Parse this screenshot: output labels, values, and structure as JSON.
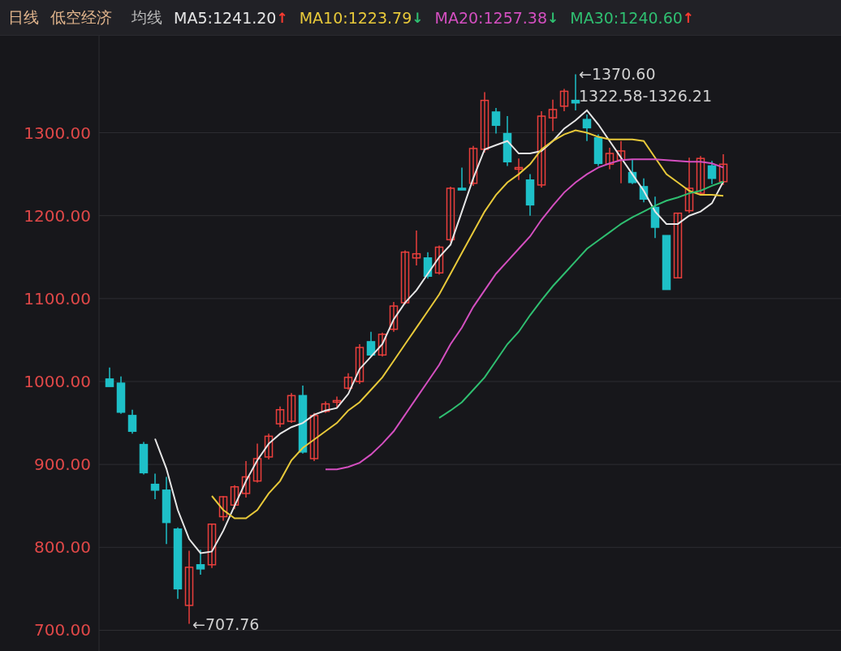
{
  "header": {
    "period": "日线",
    "sector": "低空经济",
    "ma_label": "均线",
    "indicators": [
      {
        "label": "MA5:1241.20",
        "arrow": {
          "text": "↑",
          "color": "#ff3b30"
        },
        "color": "#e6e6e6"
      },
      {
        "label": "MA10:1223.79",
        "arrow": {
          "text": "↓",
          "color": "#2fbf71"
        },
        "color": "#e8c93a"
      },
      {
        "label": "MA20:1257.38",
        "arrow": {
          "text": "↓",
          "color": "#2fbf71"
        },
        "color": "#d44fc0"
      },
      {
        "label": "MA30:1240.60",
        "arrow": {
          "text": "↑",
          "color": "#ff3b30"
        },
        "color": "#2fbf71"
      }
    ]
  },
  "chart_data": {
    "type": "candlestick",
    "ylim": [
      675,
      1417
    ],
    "grid": true,
    "yticks": [
      {
        "value": 700,
        "label": "700.00"
      },
      {
        "value": 800,
        "label": "800.00"
      },
      {
        "value": 900,
        "label": "900.00"
      },
      {
        "value": 1000,
        "label": "1000.00"
      },
      {
        "value": 1100,
        "label": "1100.00"
      },
      {
        "value": 1200,
        "label": "1200.00"
      },
      {
        "value": 1300,
        "label": "1300.00"
      }
    ],
    "series": [
      {
        "type": "line",
        "color": "#e6e6e6",
        "values": [
          null,
          null,
          null,
          null,
          931,
          895,
          845,
          810,
          793,
          795,
          820,
          850,
          880,
          905,
          925,
          937,
          945,
          950,
          960,
          965,
          968,
          985,
          1015,
          1030,
          1045,
          1075,
          1095,
          1110,
          1130,
          1150,
          1165,
          1205,
          1245,
          1280,
          1285,
          1290,
          1275,
          1275,
          1278,
          1290,
          1305,
          1315,
          1327,
          1310,
          1290,
          1270,
          1250,
          1230,
          1205,
          1190,
          1190,
          1200,
          1205,
          1215,
          1241
        ]
      },
      {
        "type": "line",
        "color": "#e8c93a",
        "values": [
          null,
          null,
          null,
          null,
          null,
          null,
          null,
          null,
          null,
          862,
          845,
          835,
          835,
          845,
          865,
          880,
          905,
          920,
          930,
          940,
          950,
          965,
          975,
          990,
          1005,
          1025,
          1045,
          1065,
          1085,
          1105,
          1130,
          1155,
          1180,
          1205,
          1225,
          1240,
          1250,
          1262,
          1280,
          1290,
          1298,
          1303,
          1300,
          1295,
          1292,
          1292,
          1292,
          1290,
          1270,
          1250,
          1240,
          1230,
          1225,
          1225,
          1224
        ]
      },
      {
        "type": "line",
        "color": "#d44fc0",
        "values": [
          null,
          null,
          null,
          null,
          null,
          null,
          null,
          null,
          null,
          null,
          null,
          null,
          null,
          null,
          null,
          null,
          null,
          null,
          null,
          894,
          894,
          897,
          902,
          912,
          925,
          940,
          960,
          980,
          1000,
          1020,
          1045,
          1065,
          1090,
          1110,
          1130,
          1145,
          1160,
          1175,
          1195,
          1212,
          1228,
          1240,
          1250,
          1258,
          1263,
          1267,
          1268,
          1268,
          1268,
          1267,
          1266,
          1265,
          1265,
          1263,
          1258
        ]
      },
      {
        "type": "line",
        "color": "#2fbf71",
        "values": [
          null,
          null,
          null,
          null,
          null,
          null,
          null,
          null,
          null,
          null,
          null,
          null,
          null,
          null,
          null,
          null,
          null,
          null,
          null,
          null,
          null,
          null,
          null,
          null,
          null,
          null,
          null,
          null,
          null,
          956,
          965,
          975,
          990,
          1005,
          1025,
          1045,
          1060,
          1080,
          1098,
          1115,
          1130,
          1145,
          1160,
          1170,
          1180,
          1190,
          1198,
          1205,
          1212,
          1218,
          1222,
          1227,
          1230,
          1236,
          1241
        ]
      }
    ],
    "ohlc": [
      [
        1003,
        1017,
        994,
        994
      ],
      [
        998,
        1006,
        961,
        963
      ],
      [
        959,
        966,
        937,
        940
      ],
      [
        924,
        927,
        888,
        890
      ],
      [
        876,
        889,
        858,
        869
      ],
      [
        869,
        885,
        804,
        830
      ],
      [
        822,
        824,
        738,
        750
      ],
      [
        730,
        796,
        707.76,
        776
      ],
      [
        779,
        797,
        767,
        774
      ],
      [
        779,
        828,
        775,
        828
      ],
      [
        837,
        862,
        832,
        861
      ],
      [
        851,
        875,
        846,
        873
      ],
      [
        865,
        904,
        860,
        885
      ],
      [
        880,
        925,
        878,
        907
      ],
      [
        909,
        937,
        906,
        934
      ],
      [
        949,
        970,
        945,
        966
      ],
      [
        952,
        986,
        950,
        983
      ],
      [
        983,
        995,
        913,
        915
      ],
      [
        907,
        962,
        904,
        959
      ],
      [
        964,
        976,
        962,
        973
      ],
      [
        975,
        982,
        968,
        977
      ],
      [
        992,
        1010,
        990,
        1005
      ],
      [
        1000,
        1045,
        997,
        1041
      ],
      [
        1048,
        1060,
        1030,
        1032
      ],
      [
        1032,
        1059,
        1030,
        1057
      ],
      [
        1063,
        1096,
        1060,
        1091
      ],
      [
        1095,
        1158,
        1093,
        1156
      ],
      [
        1149,
        1182,
        1140,
        1154
      ],
      [
        1149,
        1156,
        1124,
        1127
      ],
      [
        1131,
        1164,
        1129,
        1162
      ],
      [
        1171,
        1235,
        1168,
        1233
      ],
      [
        1233,
        1258,
        1231,
        1231
      ],
      [
        1239,
        1284,
        1236,
        1281
      ],
      [
        1280,
        1349,
        1276,
        1339
      ],
      [
        1325,
        1330,
        1299,
        1309
      ],
      [
        1299,
        1320,
        1260,
        1265
      ],
      [
        1256,
        1269,
        1243,
        1258
      ],
      [
        1243,
        1250,
        1200,
        1213
      ],
      [
        1237,
        1326,
        1234,
        1320
      ],
      [
        1318,
        1340,
        1302,
        1328
      ],
      [
        1332,
        1353,
        1326,
        1350
      ],
      [
        1339,
        1370.6,
        1327,
        1336
      ],
      [
        1316,
        1322,
        1290,
        1306
      ],
      [
        1294,
        1298,
        1260,
        1263
      ],
      [
        1262,
        1282,
        1256,
        1275
      ],
      [
        1267,
        1290,
        1239,
        1278
      ],
      [
        1252,
        1268,
        1238,
        1240
      ],
      [
        1235,
        1245,
        1216,
        1220
      ],
      [
        1210,
        1223,
        1173,
        1186
      ],
      [
        1176,
        1176,
        1111,
        1111
      ],
      [
        1125,
        1203,
        1125,
        1203
      ],
      [
        1206,
        1270,
        1203,
        1233
      ],
      [
        1227,
        1272,
        1225,
        1269
      ],
      [
        1260,
        1266,
        1238,
        1245
      ],
      [
        1241,
        1274,
        1237,
        1262
      ]
    ],
    "annotations": [
      "←1370.60",
      "1322.58-1326.21",
      "←707.76"
    ]
  }
}
